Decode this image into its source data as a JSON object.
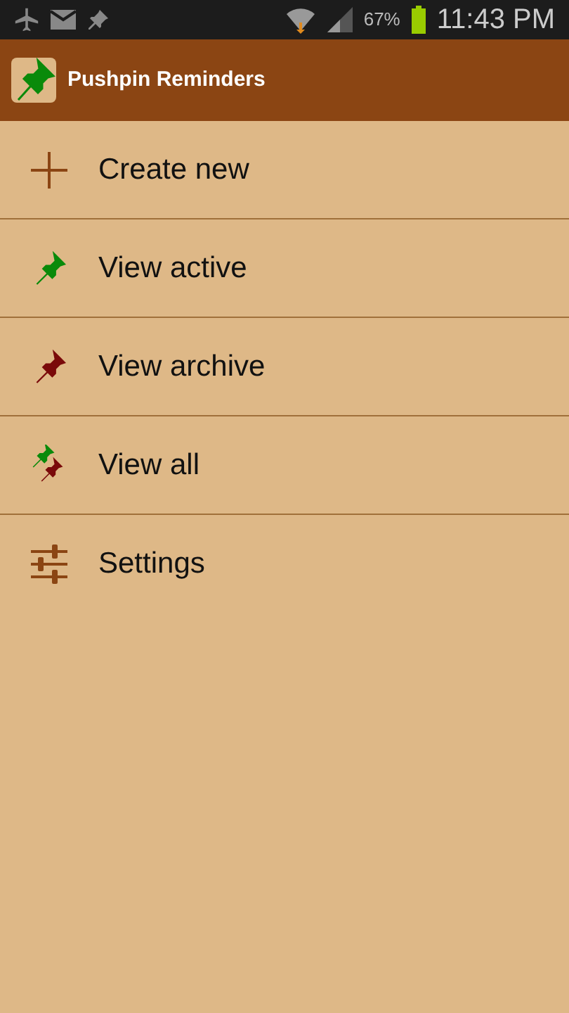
{
  "status_bar": {
    "battery": "67%",
    "time": "11:43 PM"
  },
  "app_bar": {
    "title": "Pushpin Reminders"
  },
  "menu": [
    {
      "kind": "plus",
      "label": "Create new"
    },
    {
      "kind": "pin-green",
      "label": "View active"
    },
    {
      "kind": "pin-red",
      "label": "View archive"
    },
    {
      "kind": "pins-both",
      "label": "View all"
    },
    {
      "kind": "sliders",
      "label": "Settings"
    }
  ]
}
